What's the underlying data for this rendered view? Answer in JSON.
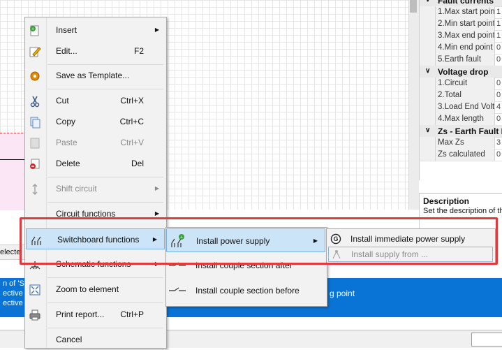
{
  "canvas": {
    "status_text": "electe",
    "info_lines": [
      "n of 'SB",
      "ective d",
      "ective d"
    ],
    "info_right": "g point"
  },
  "properties": {
    "rows": [
      {
        "type": "category",
        "label": "Fault currents"
      },
      {
        "type": "item",
        "name": "1.Max start point",
        "value": "1"
      },
      {
        "type": "item",
        "name": "2.Min start point",
        "value": "1"
      },
      {
        "type": "item",
        "name": "3.Max end point",
        "value": "1"
      },
      {
        "type": "item",
        "name": "4.Min end point",
        "value": "0"
      },
      {
        "type": "item",
        "name": "5.Earth fault",
        "value": "0"
      },
      {
        "type": "category",
        "label": "Voltage drop"
      },
      {
        "type": "item",
        "name": "1.Circuit",
        "value": "0"
      },
      {
        "type": "item",
        "name": "2.Total",
        "value": "0"
      },
      {
        "type": "item",
        "name": "3.Load End Volts",
        "value": "4"
      },
      {
        "type": "item",
        "name": "4.Max length",
        "value": "0"
      },
      {
        "type": "category",
        "label": "Zs - Earth Fault L"
      },
      {
        "type": "item",
        "name": "Max Zs",
        "value": "3"
      },
      {
        "type": "item",
        "name": "Zs calculated",
        "value": "0"
      }
    ],
    "description_title": "Description",
    "description_text": "Set the description of th"
  },
  "context_menu": {
    "items": [
      {
        "label": "Insert",
        "shortcut": "",
        "submenu": true,
        "icon": "insert-icon"
      },
      {
        "label": "Edit...",
        "shortcut": "F2",
        "submenu": false,
        "icon": "edit-pencil-icon"
      },
      {
        "label": "Save as Template...",
        "shortcut": "",
        "submenu": false,
        "icon": "template-gear-icon"
      },
      {
        "label": "Cut",
        "shortcut": "Ctrl+X",
        "submenu": false,
        "icon": "scissors-icon"
      },
      {
        "label": "Copy",
        "shortcut": "Ctrl+C",
        "submenu": false,
        "icon": "copy-icon"
      },
      {
        "label": "Paste",
        "shortcut": "Ctrl+V",
        "submenu": false,
        "icon": "paste-icon",
        "disabled": true
      },
      {
        "label": "Delete",
        "shortcut": "Del",
        "submenu": false,
        "icon": "delete-icon"
      },
      {
        "label": "Shift circuit",
        "shortcut": "",
        "submenu": true,
        "icon": "shift-arrows-icon",
        "disabled": true
      },
      {
        "label": "Circuit functions",
        "shortcut": "",
        "submenu": true,
        "icon": ""
      },
      {
        "label": "Switchboard functions",
        "shortcut": "",
        "submenu": true,
        "icon": "switchboard-icon",
        "highlighted": true
      },
      {
        "label": "Schematic functions",
        "shortcut": "",
        "submenu": true,
        "icon": "schematic-icon"
      },
      {
        "label": "Zoom to element",
        "shortcut": "",
        "submenu": false,
        "icon": "zoom-fit-icon"
      },
      {
        "label": "Print report...",
        "shortcut": "Ctrl+P",
        "submenu": false,
        "icon": "printer-icon"
      },
      {
        "label": "Cancel",
        "shortcut": "",
        "submenu": false,
        "icon": ""
      }
    ]
  },
  "switchboard_submenu": {
    "items": [
      {
        "label": "Install power supply",
        "submenu": true,
        "highlighted": true,
        "icon": "power-supply-icon"
      },
      {
        "label": "Install couple section after",
        "submenu": false,
        "icon": "couple-after-icon"
      },
      {
        "label": "Install couple section before",
        "submenu": false,
        "icon": "couple-before-icon"
      }
    ]
  },
  "power_supply_submenu": {
    "items": [
      {
        "label": "Install immediate power supply",
        "icon": "immediate-supply-icon"
      },
      {
        "label": "Install supply from ...",
        "icon": "supply-from-icon",
        "disabled": true
      }
    ]
  },
  "colors": {
    "highlight_frame": "#e0393e",
    "menu_hover": "#cce4f7",
    "info_panel": "#0a74d6"
  }
}
